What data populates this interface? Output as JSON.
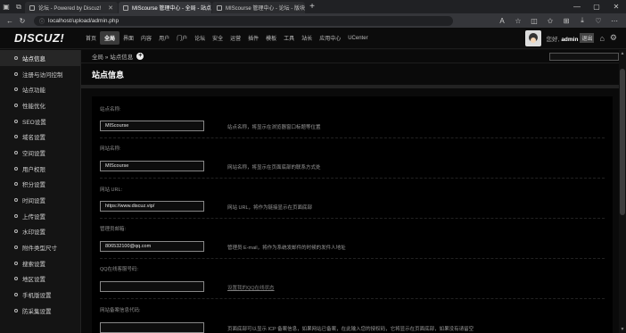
{
  "browser": {
    "tabs": [
      {
        "title": "论坛 - Powered by Discuz!"
      },
      {
        "title": "MIScourse 管理中心 - 全局 - 站点信息"
      },
      {
        "title": "MIScourse 管理中心 - 论坛 - 版块管理"
      }
    ],
    "url": "localhost/upload/admin.php",
    "new_tab": "+"
  },
  "header": {
    "logo": "DISCUZ!",
    "nav": [
      "首页",
      "全局",
      "界面",
      "内容",
      "用户",
      "门户",
      "论坛",
      "安全",
      "运营",
      "插件",
      "模板",
      "工具",
      "站长",
      "应用中心",
      "UCenter"
    ],
    "current_nav": "全局",
    "greeting": "您好,",
    "username": "admin",
    "logout": "退出"
  },
  "sidebar": {
    "items": [
      {
        "label": "站点信息",
        "current": true
      },
      {
        "label": "注册与访问控制"
      },
      {
        "label": "站点功能"
      },
      {
        "label": "性能优化"
      },
      {
        "label": "SEO设置"
      },
      {
        "label": "域名设置"
      },
      {
        "label": "空间设置"
      },
      {
        "label": "用户权限"
      },
      {
        "label": "积分设置"
      },
      {
        "label": "时间设置"
      },
      {
        "label": "上传设置"
      },
      {
        "label": "水印设置"
      },
      {
        "label": "附件类型尺寸"
      },
      {
        "label": "搜索设置"
      },
      {
        "label": "地区设置"
      },
      {
        "label": "手机版设置"
      },
      {
        "label": "防采集设置"
      }
    ]
  },
  "main": {
    "breadcrumb": "全局 » 站点信息",
    "page_title": "站点信息",
    "fields": [
      {
        "label": "站点名称:",
        "value": "MIScourse",
        "desc": "站点名称，将显示在浏览器窗口标题等位置",
        "link": false
      },
      {
        "label": "网站名称:",
        "value": "MIScourse",
        "desc": "网站名称，将显示在页面底部的联系方式处",
        "link": false
      },
      {
        "label": "网站 URL:",
        "value": "https://www.discuz.vip/",
        "desc": "网站 URL，将作为链接显示在页面底部",
        "link": false
      },
      {
        "label": "管理员邮箱:",
        "value": "806532100@qq.com",
        "desc": "管理员 E-mail，将作为系统发邮件的时候的发件人地址",
        "link": false
      },
      {
        "label": "QQ在线客服号码:",
        "value": "",
        "desc": "设置我的QQ在线状态",
        "link": true
      },
      {
        "label": "网站备案信息代码:",
        "value": "",
        "desc": "页面底部可以显示 ICP 备案信息，如果网站已备案，在此输入您的授权码，它将显示在页面底部，如果没有请留空",
        "link": false
      }
    ]
  }
}
